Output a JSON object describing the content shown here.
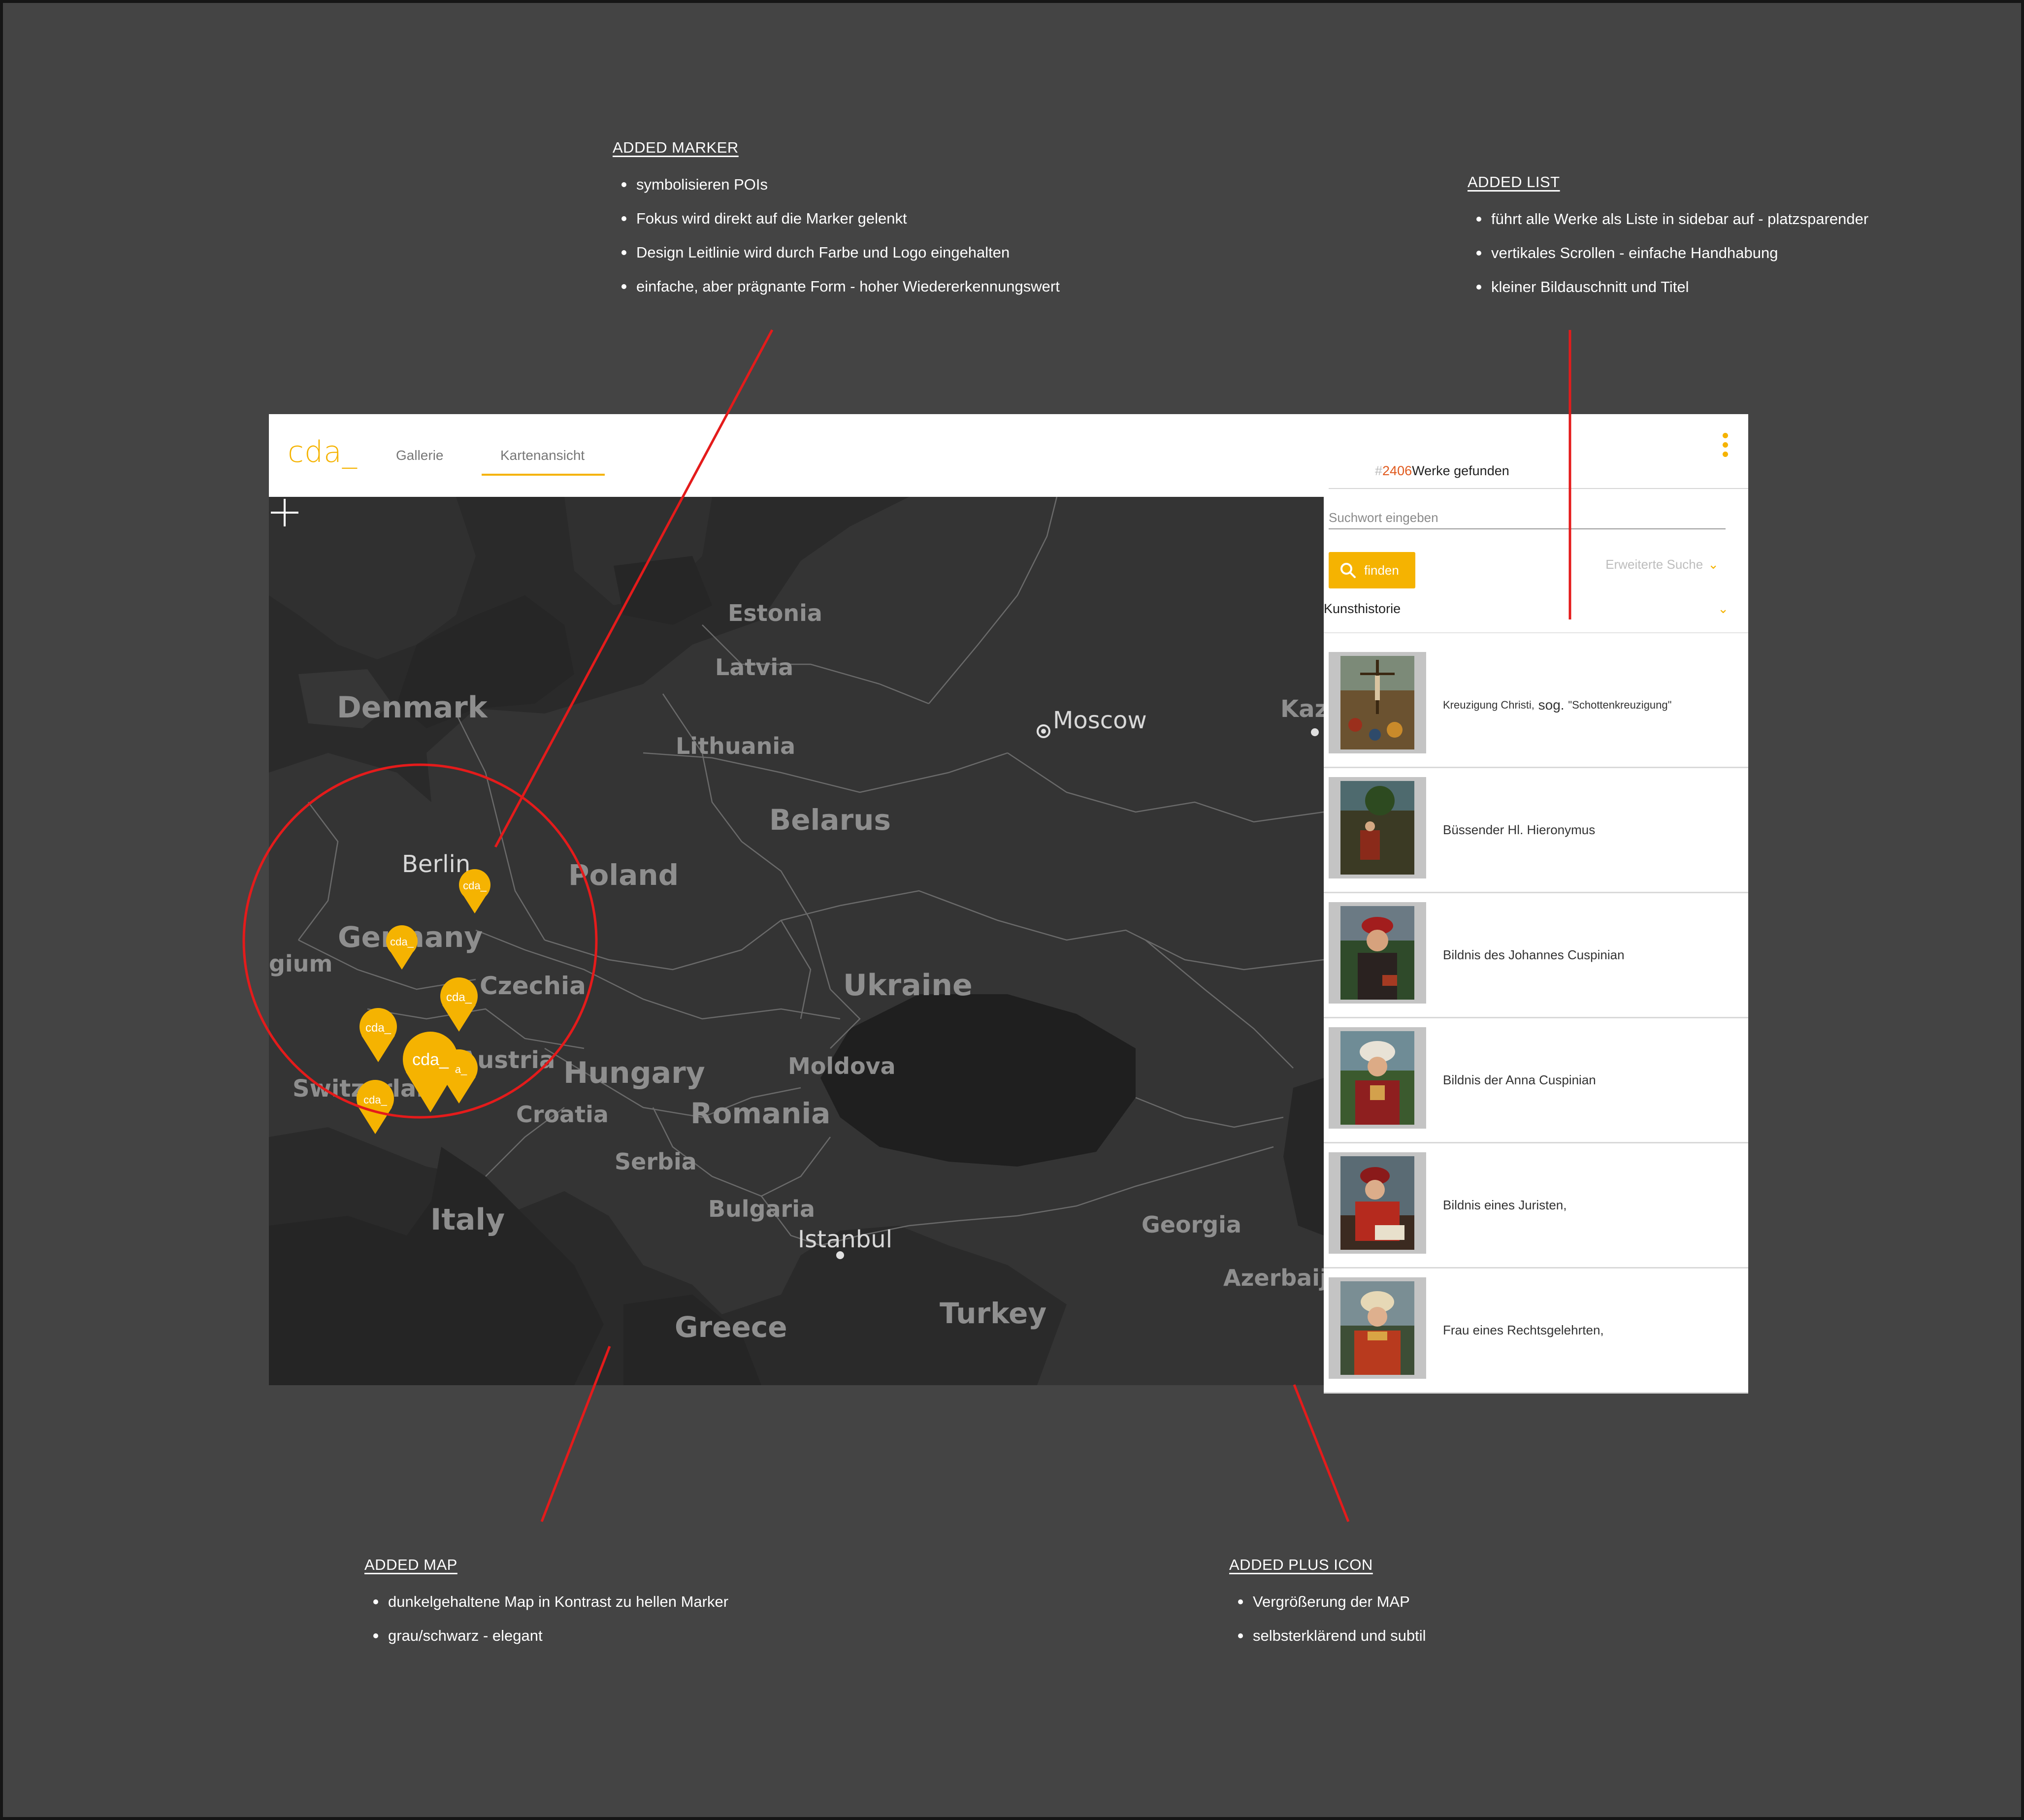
{
  "annotations": {
    "marker": {
      "title": "ADDED MARKER",
      "points": [
        "symbolisieren POIs",
        "Fokus wird direkt auf die Marker gelenkt",
        "Design Leitlinie wird durch Farbe und Logo eingehalten",
        "einfache, aber prägnante Form - hoher Wiedererkennungswert"
      ]
    },
    "list": {
      "title": "ADDED LIST",
      "points": [
        "führt alle Werke als Liste in sidebar auf - platzsparender",
        "vertikales Scrollen - einfache Handhabung",
        "kleiner Bildauschnitt und Titel"
      ]
    },
    "map": {
      "title": "ADDED MAP",
      "points": [
        "dunkelgehaltene Map in Kontrast zu hellen Marker",
        "grau/schwarz - elegant"
      ]
    },
    "plus_icon": {
      "title": "ADDED PLUS ICON",
      "points": [
        "Vergrößerung der MAP",
        "selbsterklärend und subtil"
      ]
    }
  },
  "app": {
    "logo": "cda_",
    "tabs": [
      {
        "label": "Gallerie",
        "active": false
      },
      {
        "label": "Kartenansicht",
        "active": true
      }
    ],
    "accent_color": "#f5b301",
    "menu_icon": "vertical-dots-icon"
  },
  "map": {
    "countries": [
      "Estonia",
      "Latvia",
      "Denmark",
      "Lithuania",
      "Belarus",
      "Poland",
      "Germany",
      "gium",
      "Czechia",
      "Ukraine",
      "Austria",
      "Switzerlar",
      "Hungary",
      "Moldova",
      "Romania",
      "Croatia",
      "Serbia",
      "Bulgaria",
      "Italy",
      "Georgia",
      "Azerbaija",
      "Greece",
      "Turkey",
      "Kaz"
    ],
    "cities": [
      "Moscow",
      "Berlin",
      "Istanbul"
    ],
    "marker_label": "cda_",
    "marker_overlap_label": "a_",
    "plus_icon": "plus-icon"
  },
  "sidebar": {
    "results_hash": "#",
    "results_count": "2406",
    "results_suffix": "Werke gefunden",
    "search_placeholder": "Suchwort eingeben",
    "find_label": "finden",
    "find_icon": "search-icon",
    "advanced_search": "Erweiterte Suche",
    "category": "Kunsthistorie",
    "works": [
      {
        "title_prefix": "Kreuzigung Christi,",
        "title_mid": " sog. ",
        "title_suffix": "\"Schottenkreuzigung\""
      },
      {
        "title": "Büssender Hl. Hieronymus"
      },
      {
        "title": "Bildnis des Johannes Cuspinian"
      },
      {
        "title": "Bildnis der Anna Cuspinian"
      },
      {
        "title": "Bildnis eines Juristen,"
      },
      {
        "title": "Frau eines Rechtsgelehrten,"
      }
    ]
  }
}
